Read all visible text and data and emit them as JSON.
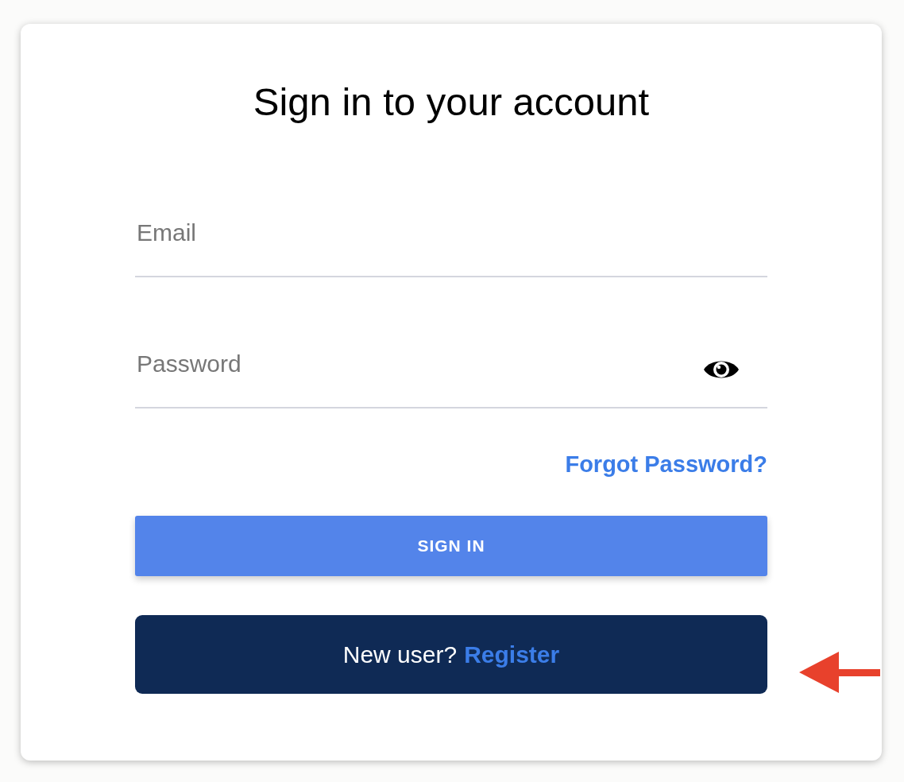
{
  "title": "Sign in to your account",
  "fields": [
    {
      "kind": "text",
      "placeholder": "Email"
    },
    {
      "kind": "password",
      "placeholder": "Password"
    }
  ],
  "forgot_link": "Forgot Password?",
  "sign_in_button": "SIGN IN",
  "register": {
    "prompt": "New user?",
    "link": "Register"
  }
}
